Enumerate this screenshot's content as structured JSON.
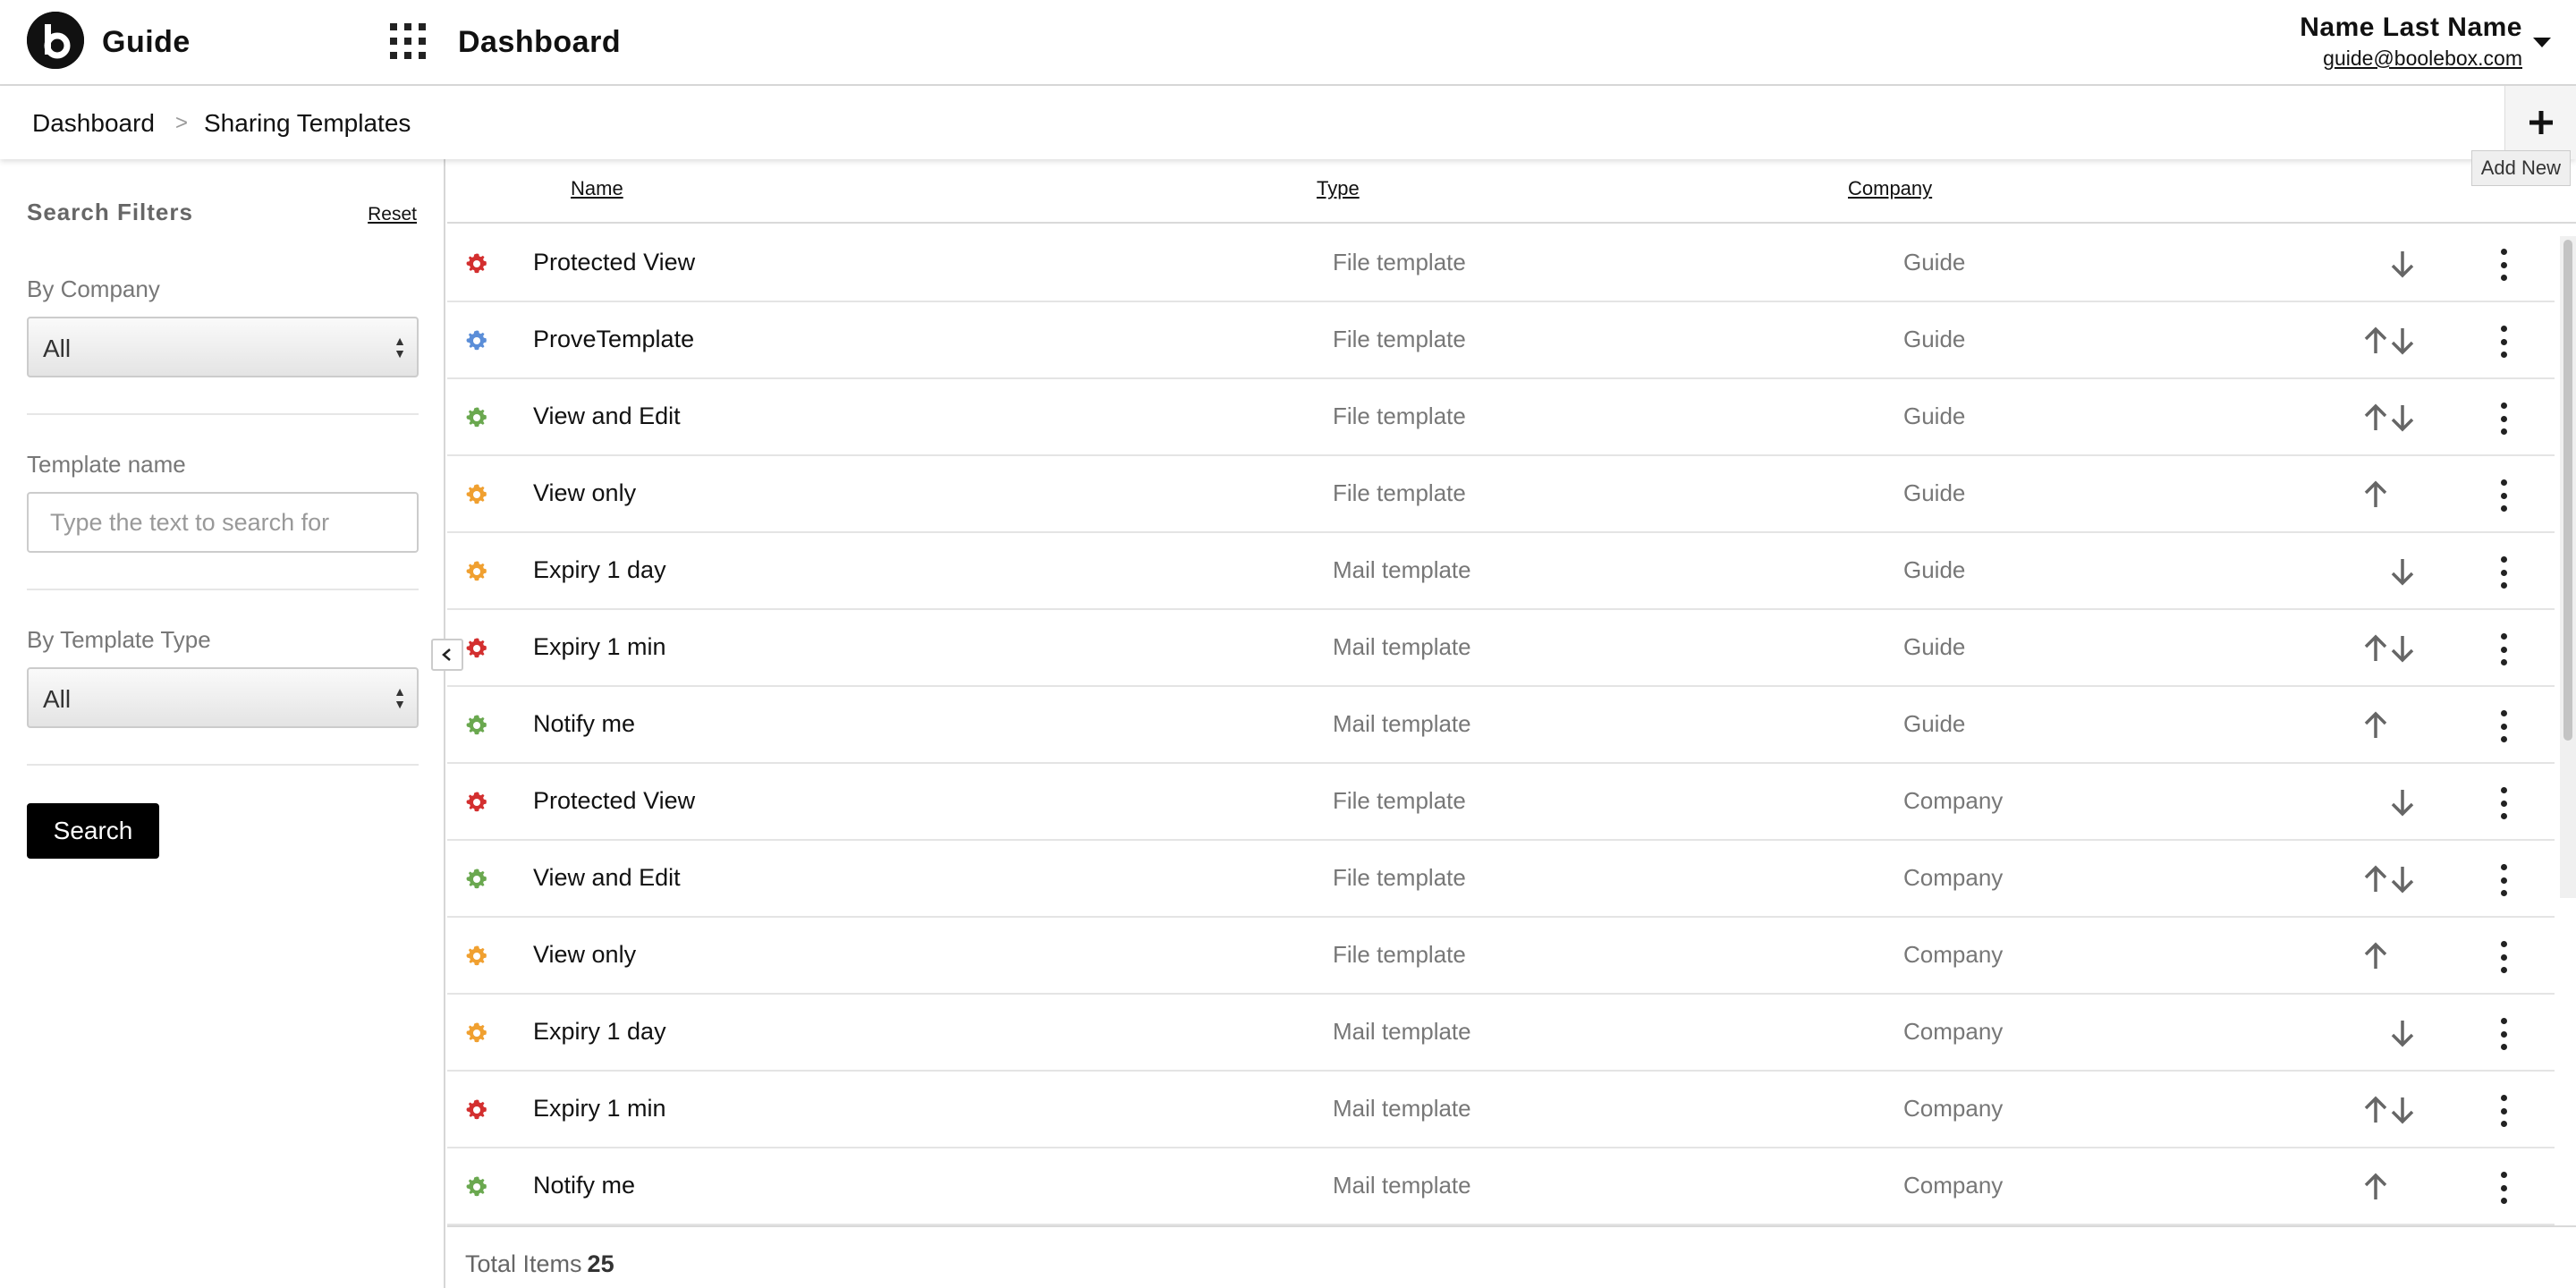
{
  "header": {
    "app_name": "Guide",
    "page_title": "Dashboard",
    "user_name": "Name Last Name",
    "user_email": "guide@boolebox.com"
  },
  "breadcrumb": {
    "items": [
      "Dashboard",
      "Sharing Templates"
    ],
    "separator": ">"
  },
  "toolbar": {
    "add_tooltip": "Add New"
  },
  "filters": {
    "title": "Search Filters",
    "reset_label": "Reset",
    "company_label": "By Company",
    "company_value": "All",
    "template_name_label": "Template name",
    "template_name_placeholder": "Type the text to search for",
    "template_type_label": "By Template Type",
    "template_type_value": "All",
    "search_label": "Search"
  },
  "table": {
    "columns": [
      "Name",
      "Type",
      "Company"
    ],
    "rows": [
      {
        "name": "Protected View",
        "type": "File template",
        "company": "Guide",
        "gear_color": "#d32f2f",
        "up": false,
        "down": true
      },
      {
        "name": "ProveTemplate",
        "type": "File template",
        "company": "Guide",
        "gear_color": "#5b8ed8",
        "up": true,
        "down": true
      },
      {
        "name": "View and Edit",
        "type": "File template",
        "company": "Guide",
        "gear_color": "#6aa84f",
        "up": true,
        "down": true
      },
      {
        "name": "View only",
        "type": "File template",
        "company": "Guide",
        "gear_color": "#f0a030",
        "up": true,
        "down": false
      },
      {
        "name": "Expiry 1 day",
        "type": "Mail template",
        "company": "Guide",
        "gear_color": "#f0a030",
        "up": false,
        "down": true
      },
      {
        "name": "Expiry 1 min",
        "type": "Mail template",
        "company": "Guide",
        "gear_color": "#d32f2f",
        "up": true,
        "down": true
      },
      {
        "name": "Notify me",
        "type": "Mail template",
        "company": "Guide",
        "gear_color": "#6aa84f",
        "up": true,
        "down": false
      },
      {
        "name": "Protected View",
        "type": "File template",
        "company": "Company",
        "gear_color": "#d32f2f",
        "up": false,
        "down": true
      },
      {
        "name": "View and Edit",
        "type": "File template",
        "company": "Company",
        "gear_color": "#6aa84f",
        "up": true,
        "down": true
      },
      {
        "name": "View only",
        "type": "File template",
        "company": "Company",
        "gear_color": "#f0a030",
        "up": true,
        "down": false
      },
      {
        "name": "Expiry 1 day",
        "type": "Mail template",
        "company": "Company",
        "gear_color": "#f0a030",
        "up": false,
        "down": true
      },
      {
        "name": "Expiry 1 min",
        "type": "Mail template",
        "company": "Company",
        "gear_color": "#d32f2f",
        "up": true,
        "down": true
      },
      {
        "name": "Notify me",
        "type": "Mail template",
        "company": "Company",
        "gear_color": "#6aa84f",
        "up": true,
        "down": false
      }
    ],
    "total_label": "Total Items",
    "total_value": "25"
  },
  "icons": {
    "logo": "boolebox-logo",
    "apps": "apps-grid-icon",
    "add": "plus-icon",
    "collapse": "chevron-left-icon",
    "row_gear": "gear-icon",
    "move_up": "arrow-up-icon",
    "move_down": "arrow-down-icon",
    "row_menu": "kebab-menu-icon"
  }
}
